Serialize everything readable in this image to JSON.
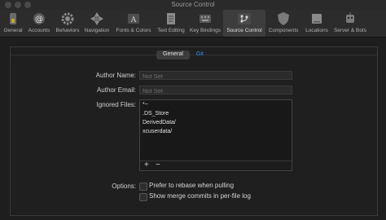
{
  "window": {
    "title": "Source Control"
  },
  "toolbar": {
    "items": [
      {
        "label": "General"
      },
      {
        "label": "Accounts"
      },
      {
        "label": "Behaviors"
      },
      {
        "label": "Navigation"
      },
      {
        "label": "Fonts & Colors"
      },
      {
        "label": "Text Editing"
      },
      {
        "label": "Key Bindings"
      },
      {
        "label": "Source Control",
        "selected": true
      },
      {
        "label": "Components"
      },
      {
        "label": "Locations"
      },
      {
        "label": "Server & Bots"
      }
    ]
  },
  "tabs": {
    "general": "General",
    "git": "Git",
    "selected": "General"
  },
  "form": {
    "author_name_label": "Author Name:",
    "author_name_placeholder": "Not Set",
    "author_email_label": "Author Email:",
    "author_email_placeholder": "Not Set",
    "ignored_files_label": "Ignored Files:",
    "ignored_files": [
      "*~",
      ".DS_Store",
      "DerivedData/",
      "xcuserdata/"
    ],
    "add_symbol": "+",
    "remove_symbol": "−",
    "options_label": "Options:",
    "options": [
      {
        "label": "Prefer to rebase when pulling",
        "checked": false
      },
      {
        "label": "Show merge commits in per-file log",
        "checked": false
      }
    ]
  },
  "colors": {
    "background": "#1e1e1e",
    "accent": "#3b8ef0",
    "toolbar": "#2c2c2c"
  }
}
